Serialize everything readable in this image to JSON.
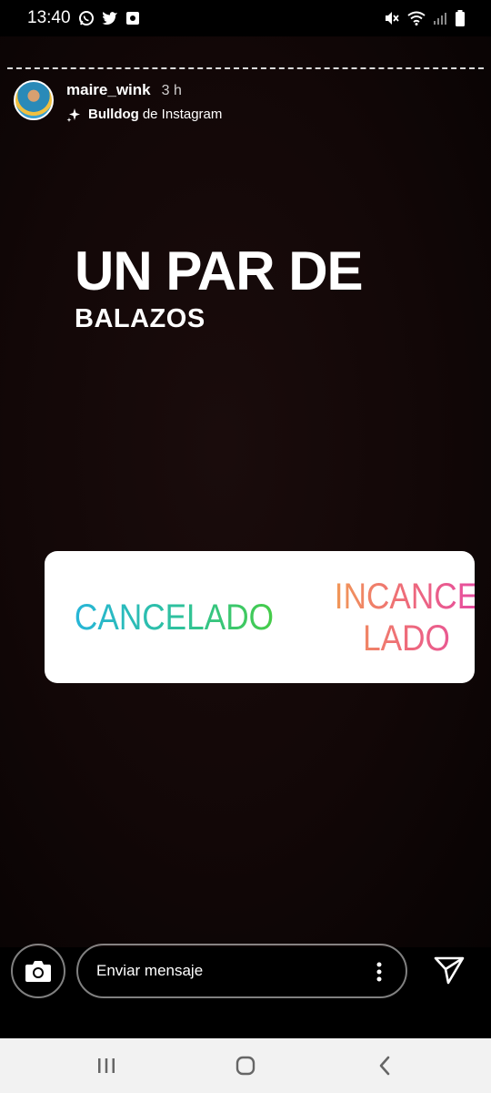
{
  "status_bar": {
    "time": "13:40",
    "left_icons": [
      "whatsapp-icon",
      "twitter-icon",
      "notification-icon"
    ],
    "right_icons": [
      "mute-icon",
      "wifi-icon",
      "signal-icon",
      "battery-icon"
    ]
  },
  "story": {
    "username": "maire_wink",
    "time_ago": "3 h",
    "effect_name": "Bulldog",
    "effect_suffix": "de Instagram",
    "headline_line1": "UN PAR DE",
    "headline_line2": "BALAZOS"
  },
  "poll": {
    "option_left": "CANCELADO",
    "option_right": "INCANCELADO",
    "left_gradient": [
      "#27b5d8",
      "#46cc47"
    ],
    "right_gradient": [
      "#f19a54",
      "#e54aa3"
    ]
  },
  "reply": {
    "placeholder": "Enviar mensaje"
  },
  "nav": {
    "icons": [
      "recent-apps-icon",
      "home-icon",
      "back-icon"
    ]
  }
}
